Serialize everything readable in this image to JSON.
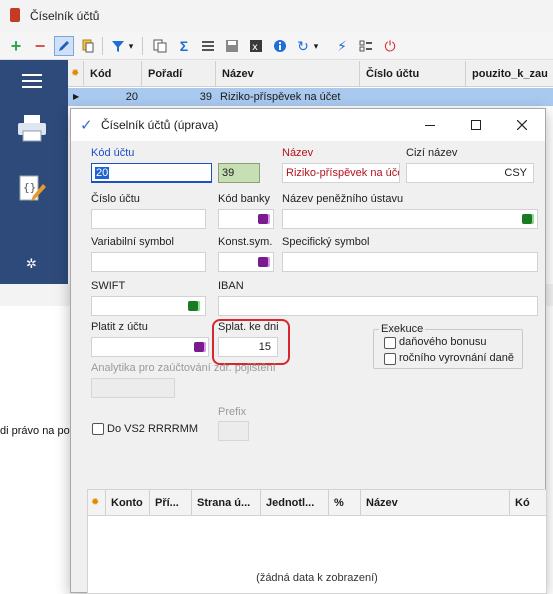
{
  "background_window": {
    "title": "Číselník účtů",
    "grid": {
      "columns": [
        "Kód",
        "Pořadí",
        "Název",
        "Číslo účtu",
        "pouzito_k_zau"
      ],
      "row": {
        "kod": "20",
        "poradi": "39",
        "nazev": "Riziko-příspěvek na účet"
      }
    },
    "side_text": "di právo na pov"
  },
  "dialog": {
    "title": "Číselník účtů (úprava)",
    "fields": {
      "kod_uctu": {
        "label": "Kód účtu",
        "value": "20",
        "color_value": "39"
      },
      "nazev": {
        "label": "Název",
        "value": "Riziko-příspěvek na úče"
      },
      "cizi_nazev": {
        "label": "Cizí název",
        "value": "CSY"
      },
      "cislo_uctu": {
        "label": "Číslo účtu",
        "value": ""
      },
      "kod_banky": {
        "label": "Kód banky",
        "value": ""
      },
      "nazev_penezniho_ustavu": {
        "label": "Název peněžního ústavu",
        "value": ""
      },
      "variabilni_symbol": {
        "label": "Variabilní symbol",
        "value": ""
      },
      "konst_sym": {
        "label": "Konst.sym.",
        "value": ""
      },
      "specificky_symbol": {
        "label": "Specifický symbol",
        "value": ""
      },
      "swift": {
        "label": "SWIFT",
        "value": ""
      },
      "iban": {
        "label": "IBAN",
        "value": ""
      },
      "platit_z_uctu": {
        "label": "Platit z účtu",
        "value": ""
      },
      "splat_ke_dni": {
        "label": "Splat. ke dni",
        "value": "15"
      },
      "analytika": {
        "label": "Analytika pro zaúčtování zdr. pojištění",
        "value": ""
      },
      "prefix": {
        "label": "Prefix",
        "value": ""
      }
    },
    "exekuce": {
      "title": "Exekuce",
      "options": [
        "daňového bonusu",
        "ročního vyrovnání daně"
      ]
    },
    "do_vs2_label": "Do VS2 RRRRMM",
    "sub_grid": {
      "columns": [
        "Konto",
        "Pří...",
        "Strana ú...",
        "Jednotl...",
        "%",
        "Název",
        "Kó"
      ],
      "empty_message": "(žádná data k zobrazení)"
    }
  },
  "colors": {
    "sidebar": "#2e4a7a",
    "selected_row": "#a9c9ef",
    "label_blue": "#1c4fc4",
    "label_red": "#b3121c",
    "highlight_ring": "#d7262e",
    "kod_color_swatch": "#c6e0b4"
  }
}
